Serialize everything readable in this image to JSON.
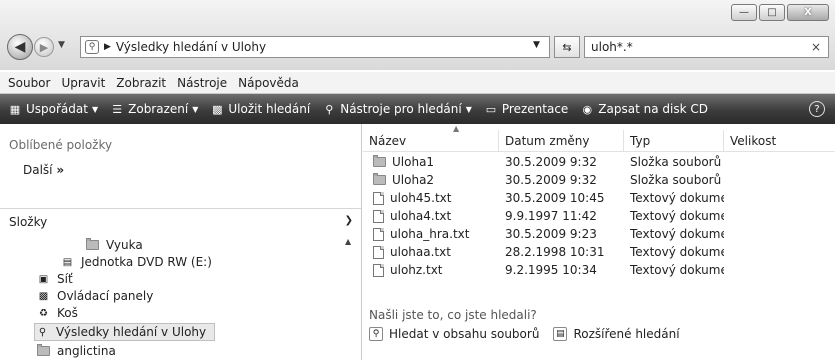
{
  "address": {
    "path": "Výsledky hledání v Ulohy"
  },
  "search": {
    "query": "uloh*.*"
  },
  "menu": [
    "Soubor",
    "Upravit",
    "Zobrazit",
    "Nástroje",
    "Nápověda"
  ],
  "toolbar": {
    "organize": "Uspořádat",
    "views": "Zobrazení",
    "save_search": "Uložit hledání",
    "search_tools": "Nástroje pro hledání",
    "slideshow": "Prezentace",
    "burn": "Zapsat na disk CD",
    "help": "?"
  },
  "nav": {
    "favorites_title": "Oblíbené položky",
    "more": "Další",
    "more_arrows": "»",
    "folders_title": "Složky",
    "tree": [
      {
        "label": "Vyuka",
        "icon": "folder-icon"
      },
      {
        "label": "Jednotka DVD RW (E:)",
        "icon": "dvd-drive-icon"
      },
      {
        "label": "Síť",
        "icon": "network-icon"
      },
      {
        "label": "Ovládací panely",
        "icon": "control-panel-icon"
      },
      {
        "label": "Koš",
        "icon": "recycle-bin-icon"
      },
      {
        "label": "Výsledky hledání v Ulohy",
        "icon": "search-folder-icon"
      },
      {
        "label": "anglictina",
        "icon": "folder-icon"
      }
    ]
  },
  "columns": {
    "name": "Název",
    "date": "Datum změny",
    "type": "Typ",
    "size": "Velikost"
  },
  "files": [
    {
      "name": "Uloha1",
      "date": "30.5.2009 9:32",
      "type": "Složka souborů",
      "kind": "folder"
    },
    {
      "name": "Uloha2",
      "date": "30.5.2009 9:32",
      "type": "Složka souborů",
      "kind": "folder"
    },
    {
      "name": "uloh45.txt",
      "date": "30.5.2009 10:45",
      "type": "Textový dokument",
      "kind": "file"
    },
    {
      "name": "uloha4.txt",
      "date": "9.9.1997 11:42",
      "type": "Textový dokument",
      "kind": "file"
    },
    {
      "name": "uloha_hra.txt",
      "date": "30.5.2009 9:23",
      "type": "Textový dokument",
      "kind": "file"
    },
    {
      "name": "ulohaa.txt",
      "date": "28.2.1998 10:31",
      "type": "Textový dokument",
      "kind": "file"
    },
    {
      "name": "ulohz.txt",
      "date": "9.2.1995 10:34",
      "type": "Textový dokument",
      "kind": "file"
    }
  ],
  "found": {
    "question": "Našli jste to, co jste hledali?",
    "search_contents": "Hledat v obsahu souborů",
    "advanced": "Rozšířené hledání"
  }
}
